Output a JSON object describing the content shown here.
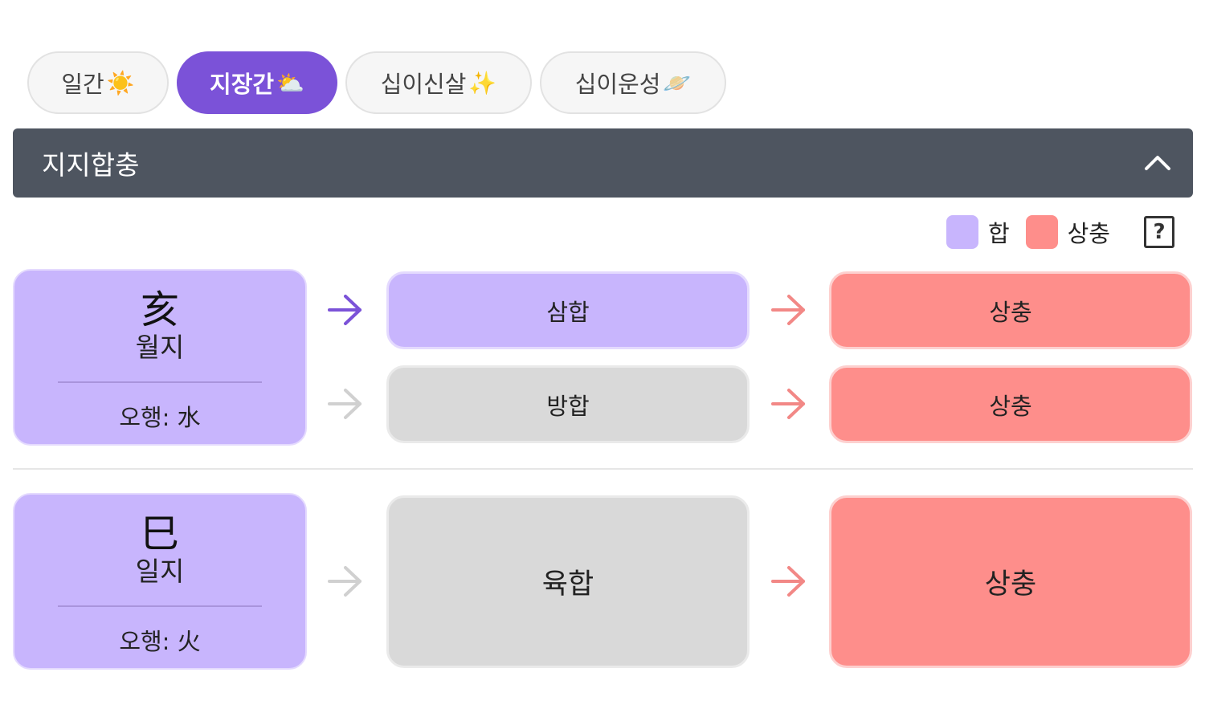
{
  "tabs": [
    {
      "label": "일간",
      "emoji": "☀️"
    },
    {
      "label": "지장간",
      "emoji": "⛅"
    },
    {
      "label": "십이신살",
      "emoji": "✨"
    },
    {
      "label": "십이운성",
      "emoji": "🪐"
    }
  ],
  "active_tab": "지장간",
  "section": {
    "title": "지지합충"
  },
  "legend": {
    "hap_label": "합",
    "chung_label": "상충",
    "help": "?",
    "hap_color": "#c8b5fd",
    "chung_color": "#fe8e8b"
  },
  "rows": [
    {
      "hanja": "亥",
      "pillar": "월지",
      "element": "오행: 水",
      "combos": [
        {
          "label": "삼합",
          "state": "active",
          "result": "상충"
        },
        {
          "label": "방합",
          "state": "inactive",
          "result": "상충"
        }
      ]
    },
    {
      "hanja": "巳",
      "pillar": "일지",
      "element": "오행: 火",
      "combos": [
        {
          "label": "육합",
          "state": "inactive",
          "result": "상충"
        }
      ]
    }
  ],
  "colors": {
    "accent": "#7b52d8",
    "header_bg": "#4e5560",
    "arrow_active": "#7b52d8",
    "arrow_inactive": "#d0d0d0",
    "arrow_chung": "#f28886"
  }
}
